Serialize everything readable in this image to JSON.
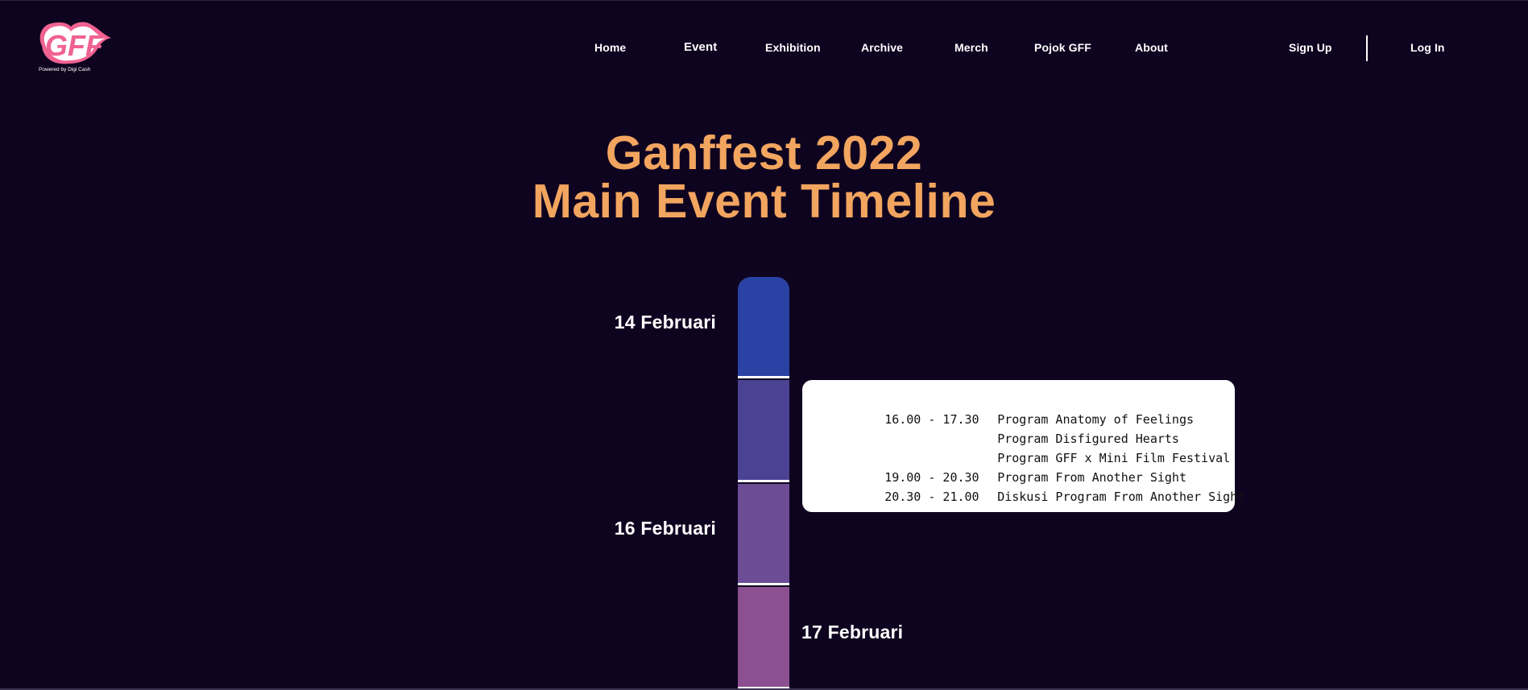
{
  "header": {
    "logo_text": "GFF",
    "logo_powered": "Powered by Digi Cash",
    "nav": [
      {
        "label": "Home"
      },
      {
        "label": "Event"
      },
      {
        "label": "Exhibition"
      },
      {
        "label": "Archive"
      },
      {
        "label": "Merch"
      },
      {
        "label": "Pojok GFF"
      },
      {
        "label": "About"
      }
    ],
    "sign_up": "Sign Up",
    "log_in": "Log In"
  },
  "title": {
    "line1": "Ganffest 2022",
    "line2": "Main Event Timeline",
    "color": "#f2a55f"
  },
  "timeline": {
    "colors": [
      "#2942a3",
      "#4b4294",
      "#6b4c95",
      "#8c4f90"
    ],
    "dates": [
      {
        "label": "14 Februari"
      },
      {
        "label": "16 Februari"
      },
      {
        "label": "17 Februari"
      }
    ],
    "schedule": [
      {
        "time": "16.00 - 17.30",
        "program": "Program Anatomy of Feelings"
      },
      {
        "time": "",
        "program": "Program Disfigured Hearts"
      },
      {
        "time": "",
        "program": "Program GFF x Mini Film Festival"
      },
      {
        "time": "19.00 - 20.30",
        "program": "Program From Another Sight"
      },
      {
        "time": "20.30 - 21.00",
        "program": "Diskusi Program From Another Sight"
      }
    ]
  }
}
